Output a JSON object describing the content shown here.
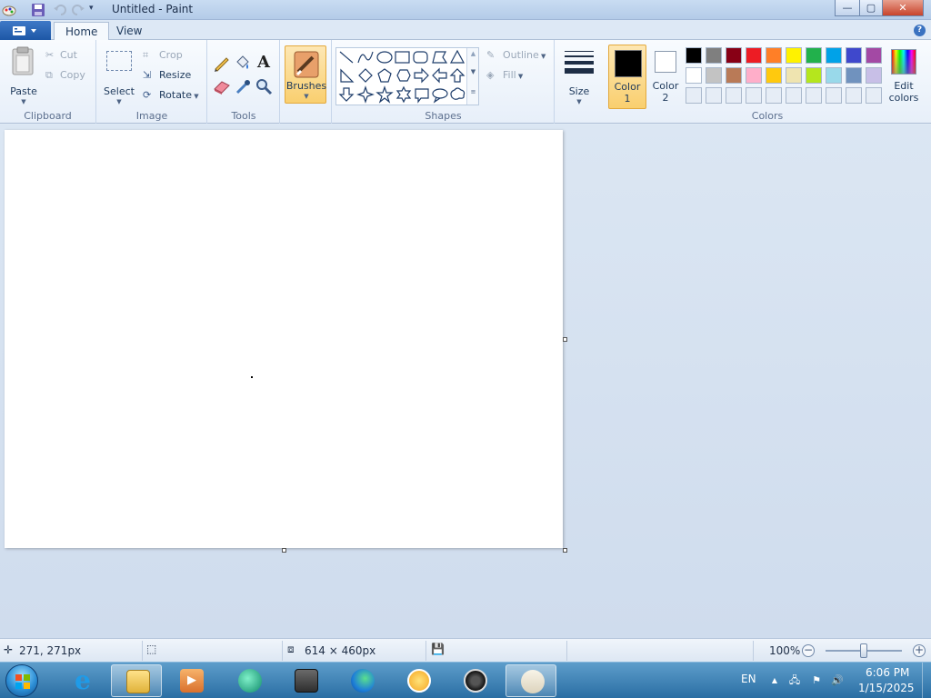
{
  "window": {
    "title": "Untitled - Paint",
    "controls": {
      "minimize": "—",
      "maximize": "▢",
      "close": "✕"
    }
  },
  "tabs": [
    {
      "label": "Home",
      "active": true
    },
    {
      "label": "View",
      "active": false
    }
  ],
  "help_icon": "?",
  "ribbon": {
    "clipboard": {
      "label": "Clipboard",
      "paste": "Paste",
      "cut": "Cut",
      "copy": "Copy"
    },
    "image": {
      "label": "Image",
      "select": "Select",
      "crop": "Crop",
      "resize": "Resize",
      "rotate": "Rotate"
    },
    "tools": {
      "label": "Tools",
      "icons": [
        "pencil-icon",
        "fill-icon",
        "text-icon",
        "eraser-icon",
        "color-picker-icon",
        "magnifier-icon"
      ]
    },
    "brushes": {
      "label": "Brushes"
    },
    "shapes": {
      "label": "Shapes",
      "outline": "Outline",
      "fill": "Fill",
      "items": [
        "line",
        "curve",
        "oval",
        "rectangle",
        "rounded-rectangle",
        "polygon",
        "triangle",
        "right-triangle",
        "diamond",
        "pentagon",
        "hexagon",
        "right-arrow",
        "left-arrow",
        "up-arrow",
        "down-arrow",
        "four-point-star",
        "five-point-star",
        "six-point-star",
        "rounded-callout",
        "oval-callout",
        "cloud-callout"
      ]
    },
    "size": {
      "label": "Size"
    },
    "color1": {
      "line1": "Color",
      "line2": "1",
      "value": "#000000"
    },
    "color2": {
      "line1": "Color",
      "line2": "2",
      "value": "#ffffff"
    },
    "colors": {
      "label": "Colors",
      "row1": [
        "#000000",
        "#7f7f7f",
        "#880015",
        "#ed1c24",
        "#ff7f27",
        "#fff200",
        "#22b14c",
        "#00a2e8",
        "#3f48cc",
        "#a349a4"
      ],
      "row2": [
        "#ffffff",
        "#c3c3c3",
        "#b97a57",
        "#ffaec9",
        "#ffc90e",
        "#efe4b0",
        "#b5e61d",
        "#99d9ea",
        "#7092be",
        "#c8bfe7"
      ],
      "edit_line1": "Edit",
      "edit_line2": "colors"
    }
  },
  "status": {
    "cursor_pos": "271, 271px",
    "selection_size": "",
    "image_size": "614 × 460px",
    "zoom": "100%",
    "zoom_level_fraction": 0.5
  },
  "taskbar": {
    "apps": [
      "internet-explorer",
      "file-explorer",
      "media-player",
      "app-green",
      "winrar",
      "edge",
      "vpn-shield",
      "obs-studio",
      "paint"
    ],
    "language": "EN",
    "time": "6:06 PM",
    "date": "1/15/2025"
  }
}
